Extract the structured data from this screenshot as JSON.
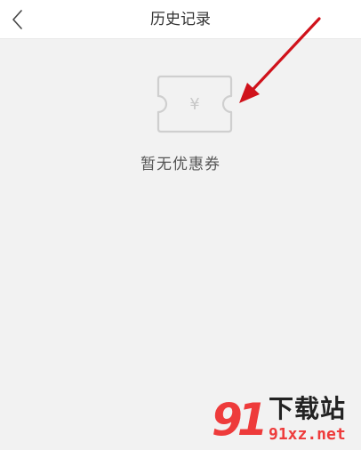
{
  "header": {
    "title": "历史记录",
    "back_icon": "chevron-left-icon"
  },
  "empty_state": {
    "icon": "coupon-icon",
    "currency_symbol": "¥",
    "message": "暂无优惠券"
  },
  "annotation": {
    "arrow_color": "#d0121b"
  },
  "watermark": {
    "logo_number": "91",
    "site_name": "下载站",
    "url": "91xz.net"
  },
  "colors": {
    "background": "#f2f2f2",
    "header_bg": "#ffffff",
    "icon_stroke": "#cfcfcf",
    "brand_red": "#ee3b3b"
  }
}
